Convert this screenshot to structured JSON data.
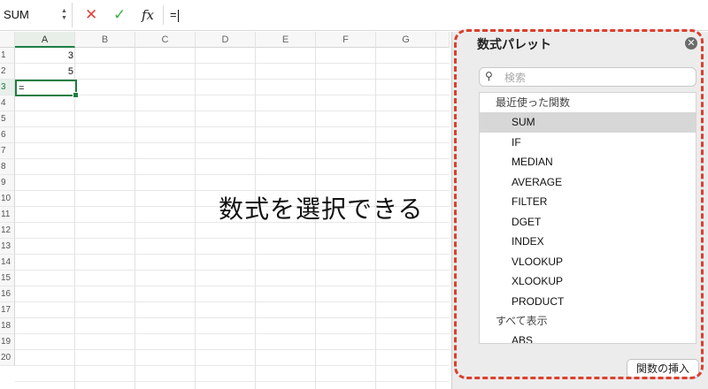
{
  "formula_bar": {
    "name_box": "SUM",
    "cancel_icon": "✕",
    "confirm_icon": "✓",
    "fx_label": "fx",
    "input_value": "="
  },
  "sheet": {
    "columns": [
      "A",
      "B",
      "C",
      "D",
      "E",
      "F",
      "G"
    ],
    "rows": [
      "1",
      "2",
      "3",
      "4",
      "5",
      "6",
      "7",
      "8",
      "9",
      "10",
      "11",
      "12",
      "13",
      "14",
      "15",
      "16",
      "17",
      "18",
      "19",
      "20"
    ],
    "cells": {
      "A1": "3",
      "A2": "5",
      "A3": "="
    },
    "active_cell": "A3"
  },
  "annotation": "数式を選択できる",
  "palette": {
    "title": "数式パレット",
    "close_icon": "✕",
    "search_icon": "🔍",
    "search_placeholder": "検索",
    "recent_group": "最近使った関数",
    "recent_functions": [
      "SUM",
      "IF",
      "MEDIAN",
      "AVERAGE",
      "FILTER",
      "DGET",
      "INDEX",
      "VLOOKUP",
      "XLOOKUP",
      "PRODUCT"
    ],
    "all_group": "すべて表示",
    "all_functions": [
      "ABS"
    ],
    "selected_function": "SUM",
    "insert_button": "関数の挿入"
  },
  "colors": {
    "accent_green": "#1d7e43",
    "highlight_dash": "#dc3f2e",
    "cancel_red": "#e0413b",
    "confirm_green": "#3fae49"
  }
}
